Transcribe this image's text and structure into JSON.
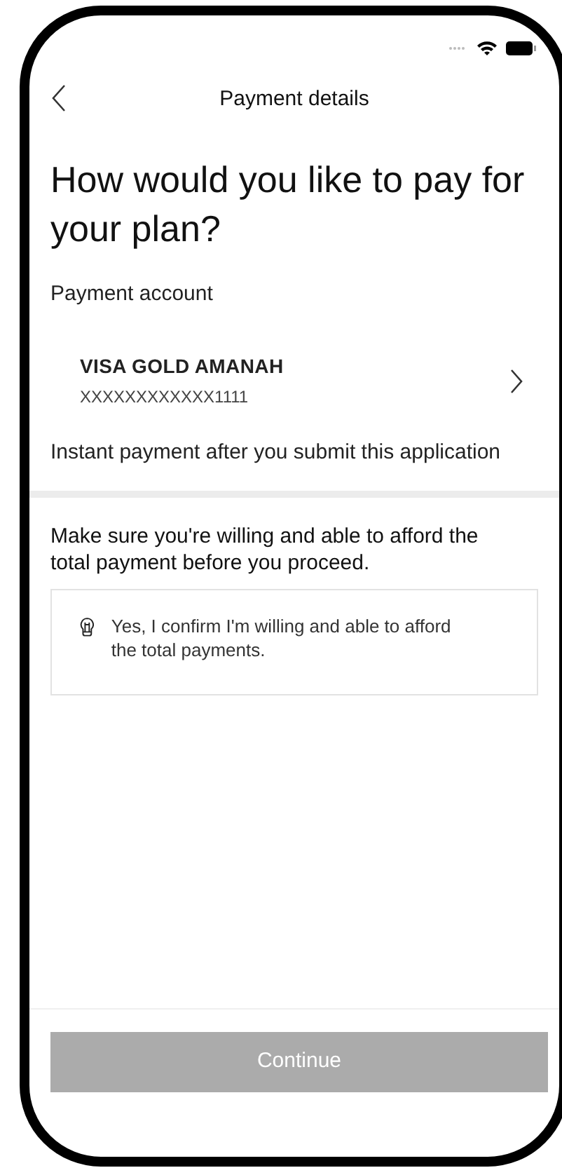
{
  "nav": {
    "title": "Payment details"
  },
  "heading": "How would you like to pay for your plan?",
  "payment_account": {
    "label": "Payment account",
    "card_name": "VISA GOLD AMANAH",
    "card_number": "XXXXXXXXXXXX1111",
    "note": "Instant payment after you submit this application"
  },
  "affordability": {
    "text": "Make sure you're willing and able to afford the total payment before you proceed.",
    "confirm": {
      "label": "Yes, I confirm I'm willing and able to afford the total payments.",
      "checked": false
    }
  },
  "continue_button": {
    "label": "Continue",
    "disabled": true
  }
}
